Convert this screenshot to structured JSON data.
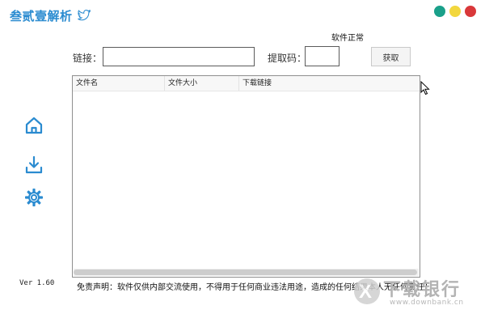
{
  "app": {
    "title": "叁贰壹解析",
    "title_icon": "bird-icon"
  },
  "window_buttons": [
    {
      "name": "teal",
      "color": "#1aa08a"
    },
    {
      "name": "yellow",
      "color": "#f2d73e"
    },
    {
      "name": "red",
      "color": "#d9383a"
    }
  ],
  "status": "软件正常",
  "form": {
    "link_label": "链接：",
    "link_value": "",
    "code_label": "提取码：",
    "code_value": "",
    "fetch_label": "获取"
  },
  "table": {
    "columns": [
      "文件名",
      "文件大小",
      "下载链接"
    ],
    "rows": []
  },
  "sidebar": {
    "items": [
      {
        "icon": "home-icon"
      },
      {
        "icon": "download-icon"
      },
      {
        "icon": "gear-icon"
      }
    ]
  },
  "footer": {
    "version": "Ver 1.60",
    "disclaimer": "免责声明：软件仅供内部交流使用，不得用于任何商业违法用途，造成的任何结果本人无任何责任！"
  },
  "watermark": {
    "mark": "X",
    "name": "下载银行",
    "url": "www.downbank.cn"
  },
  "colors": {
    "accent": "#2a8bd0"
  }
}
